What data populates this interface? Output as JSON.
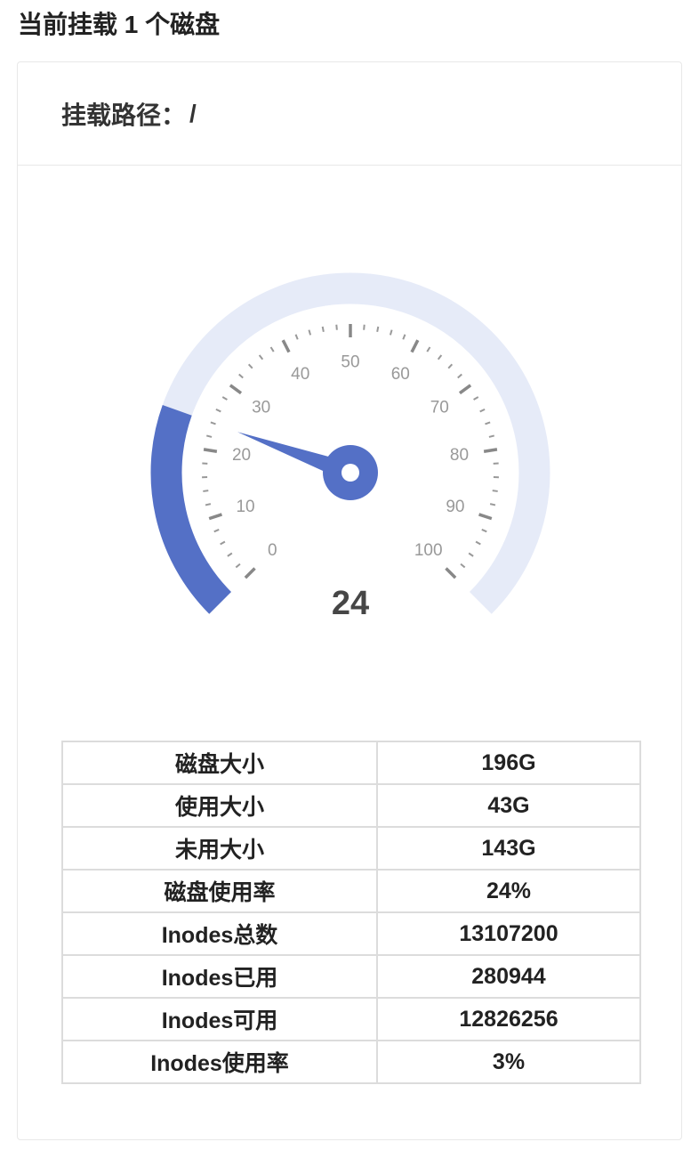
{
  "header": {
    "title": "当前挂载 1 个磁盘"
  },
  "disk": {
    "mount_label": "挂载路径：",
    "mount_path": "/",
    "gauge": {
      "value": 24,
      "value_text": "24",
      "min": 0,
      "max": 100,
      "tick_labels": [
        "0",
        "10",
        "20",
        "30",
        "40",
        "50",
        "60",
        "70",
        "80",
        "90",
        "100"
      ],
      "colors": {
        "fill": "#5470c6",
        "track": "#e6ebf8",
        "tick": "#999999",
        "label": "#999999",
        "value": "#464646"
      }
    },
    "stats": [
      {
        "label": "磁盘大小",
        "value": "196G"
      },
      {
        "label": "使用大小",
        "value": "43G"
      },
      {
        "label": "未用大小",
        "value": "143G"
      },
      {
        "label": "磁盘使用率",
        "value": "24%"
      },
      {
        "label": "Inodes总数",
        "value": "13107200"
      },
      {
        "label": "Inodes已用",
        "value": "280944"
      },
      {
        "label": "Inodes可用",
        "value": "12826256"
      },
      {
        "label": "Inodes使用率",
        "value": "3%"
      }
    ]
  }
}
